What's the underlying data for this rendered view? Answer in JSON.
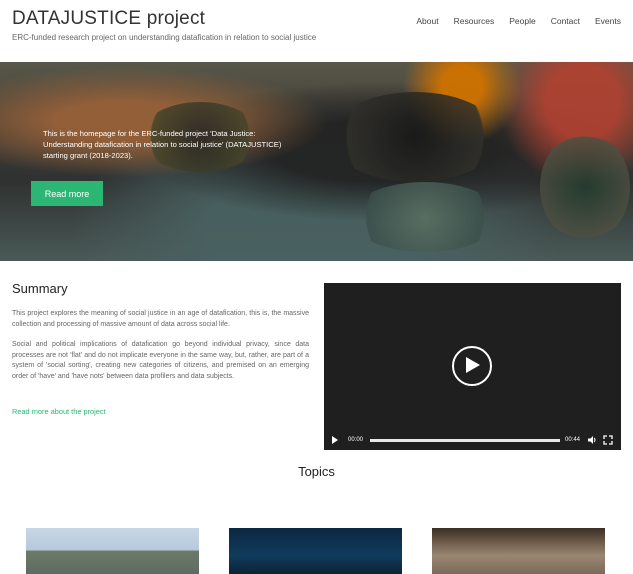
{
  "site": {
    "title": "DATAJUSTICE project",
    "tagline": "ERC-funded research project on understanding datafication in relation to social justice"
  },
  "nav": {
    "items": [
      "About",
      "Resources",
      "People",
      "Contact",
      "Events"
    ]
  },
  "hero": {
    "text": "This is the homepage for the ERC-funded project 'Data Justice: Understanding datafication in relation to social justice' (DATAJUSTICE) starting grant (2018-2023).",
    "button_label": "Read more"
  },
  "summary": {
    "title": "Summary",
    "paragraph1": "This project explores the meaning of social justice in an age of datafication, this is, the massive collection and processing of massive amount of data across social life.",
    "paragraph2": "Social and political implications of datafication go beyond individual privacy, since data processes are not 'flat' and do not implicate everyone in the same way, but, rather, are part of a system of 'social sorting', creating new categories of citizens, and premised on an emerging order of 'have' and 'have nots' between data profilers and data subjects.",
    "read_more": "Read more about the project"
  },
  "video": {
    "current_time": "00:00",
    "duration": "00:44",
    "progress": 0
  },
  "topics": {
    "title": "Topics"
  },
  "colors": {
    "accent": "#2bb673",
    "video_bg": "#1f1f1f"
  }
}
